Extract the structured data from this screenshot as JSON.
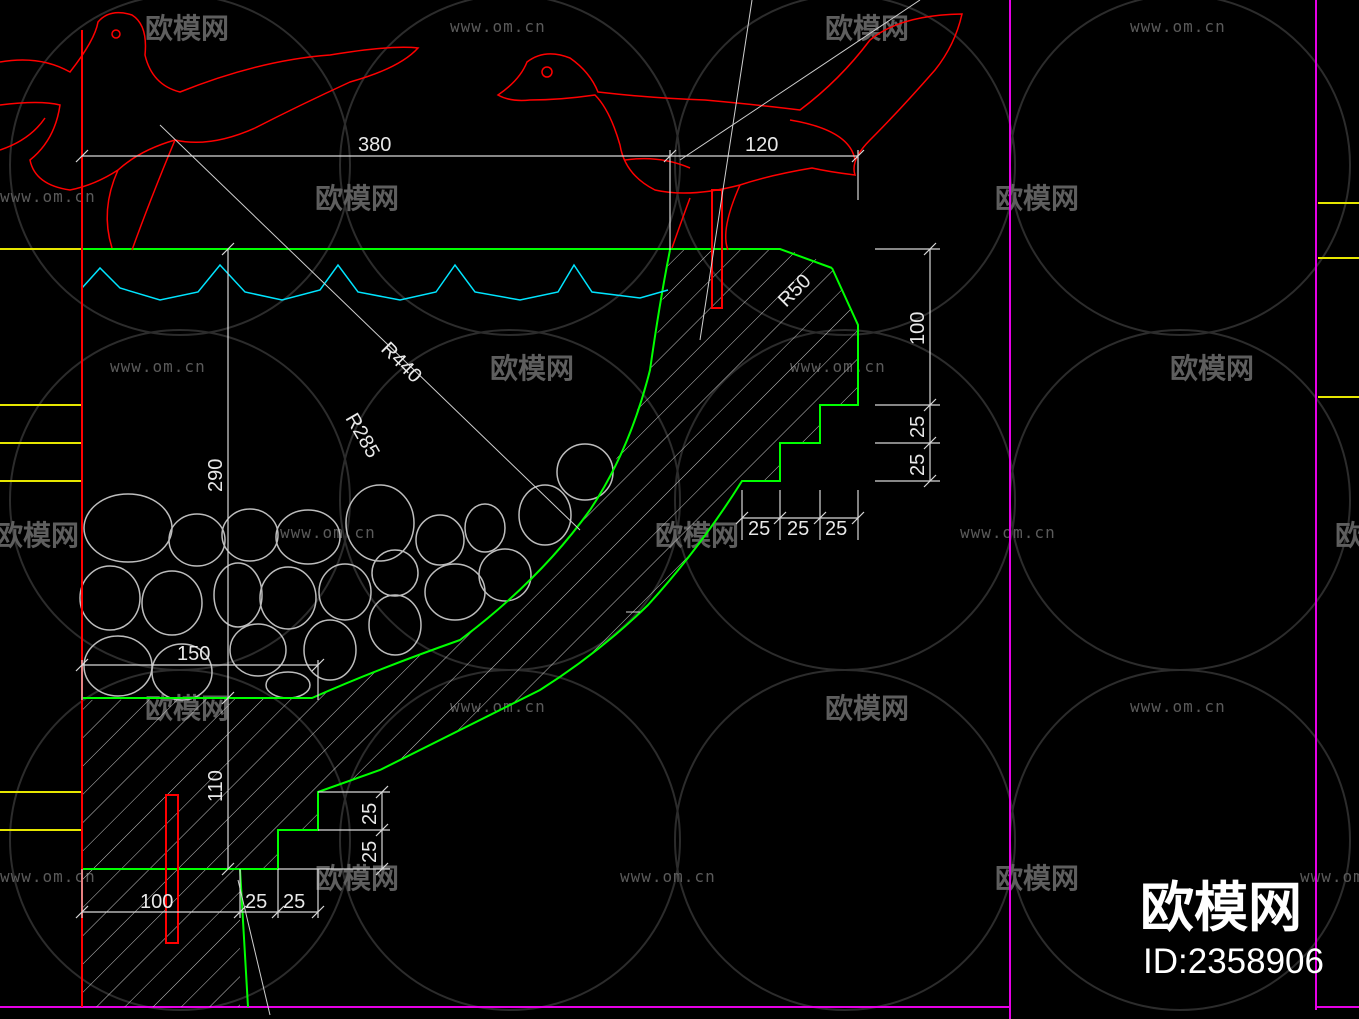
{
  "drawing": {
    "dimensions": {
      "top_width": "380",
      "top_right": "120",
      "radius_outer": "R440",
      "radius_inner": "R285",
      "radius_corner": "R50",
      "right_height": "100",
      "right_step_1": "25",
      "right_step_2": "25",
      "bottom_step_1": "25",
      "bottom_step_2": "25",
      "bottom_step_3": "25",
      "left_height": "290",
      "pebble_width": "150",
      "lower_height": "110",
      "lower_step_1": "25",
      "lower_step_2": "25",
      "base_width": "100",
      "base_step_1": "25",
      "base_step_2": "25"
    },
    "colors": {
      "background": "#000000",
      "outline": "#00ff00",
      "water": "#00e5ff",
      "bird": "#ff0000",
      "wall": "#ff0000",
      "frame": "#e600e6",
      "guides": "#ffff00",
      "dimension": "#d8d8d8",
      "stones": "#bdbdbd"
    }
  },
  "watermark": {
    "site": "www.om.cn",
    "brand": "欧模网"
  },
  "logo": {
    "brand": "欧模网",
    "id": "ID:2358906"
  }
}
